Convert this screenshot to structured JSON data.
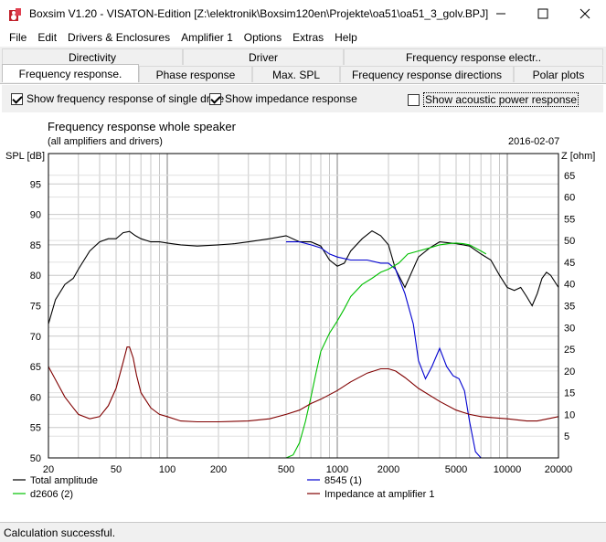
{
  "window": {
    "title": "Boxsim V1.20 - VISATON-Edition [Z:\\elektronik\\Boxsim120en\\Projekte\\oa51\\oa51_3_golv.BPJ]"
  },
  "menu": [
    "File",
    "Edit",
    "Drivers & Enclosures",
    "Amplifier 1",
    "Options",
    "Extras",
    "Help"
  ],
  "tabs_row1": [
    "Directivity",
    "Driver",
    "Frequency response electr.."
  ],
  "tabs_row2": [
    "Frequency response.",
    "Phase response",
    "Max. SPL",
    "Frequency response directions",
    "Polar plots"
  ],
  "active_tab": "Frequency response.",
  "options": {
    "single_drive": {
      "label": "Show frequency response of single drive",
      "checked": true
    },
    "impedance": {
      "label": "Show impedance response",
      "checked": true
    },
    "acoustic_power": {
      "label": "Show acoustic power response",
      "checked": false
    }
  },
  "status": "Calculation successful.",
  "chart_data": {
    "type": "line",
    "title": "Frequency response whole speaker",
    "subtitle": "(all amplifiers and drivers)",
    "date": "2016-02-07",
    "ylabel": "SPL [dB]",
    "y2label": "Z [ohm]",
    "xscale": "log",
    "xlim": [
      20,
      20000
    ],
    "ylim": [
      50,
      100
    ],
    "y2lim": [
      0,
      70
    ],
    "xticks": [
      20,
      50,
      100,
      200,
      500,
      1000,
      2000,
      5000,
      10000,
      20000
    ],
    "xticklabels": [
      "20",
      "50",
      "100",
      "200",
      "500",
      "1000",
      "2000",
      "5000",
      "10000",
      "20000"
    ],
    "yticks": [
      50,
      55,
      60,
      65,
      70,
      75,
      80,
      85,
      90,
      95
    ],
    "y2ticks": [
      5,
      10,
      15,
      20,
      25,
      30,
      35,
      40,
      45,
      50,
      55,
      60,
      65
    ],
    "grid": true,
    "legend_position": "bottom",
    "colors": {
      "total": "#000000",
      "d2606": "#00c000",
      "8545": "#0000d0",
      "impedance": "#800000"
    },
    "series": [
      {
        "name": "Total amplitude",
        "axis": "left",
        "color": "#000000",
        "x": [
          20,
          22,
          25,
          28,
          30,
          35,
          40,
          45,
          50,
          55,
          60,
          65,
          70,
          80,
          90,
          100,
          120,
          150,
          200,
          250,
          300,
          400,
          500,
          600,
          700,
          800,
          900,
          1000,
          1100,
          1200,
          1400,
          1600,
          1800,
          2000,
          2200,
          2500,
          3000,
          3500,
          4000,
          5000,
          6000,
          7000,
          8000,
          9000,
          10000,
          11000,
          12000,
          13000,
          14000,
          15000,
          16000,
          17000,
          18000,
          20000
        ],
        "y": [
          72,
          76,
          78.5,
          79.5,
          81,
          84,
          85.5,
          86,
          86,
          87,
          87.2,
          86.5,
          86,
          85.5,
          85.5,
          85.3,
          85,
          84.8,
          85,
          85.2,
          85.5,
          86,
          86.5,
          85.5,
          85.5,
          84.8,
          82.5,
          81.5,
          82,
          84,
          86,
          87.3,
          86.5,
          85,
          81,
          78,
          83,
          84.5,
          85.5,
          85.2,
          84.8,
          83.5,
          82.5,
          80,
          78,
          77.5,
          78,
          76.5,
          75,
          77,
          79.5,
          80.5,
          80,
          78
        ]
      },
      {
        "name": "8545 (1)",
        "axis": "left",
        "color": "#0000d0",
        "x": [
          500,
          600,
          700,
          800,
          900,
          1000,
          1200,
          1500,
          1800,
          2000,
          2200,
          2500,
          2800,
          3000,
          3300,
          3600,
          4000,
          4400,
          4800,
          5200,
          5600,
          6000,
          6500,
          7000,
          8000,
          10000,
          20000
        ],
        "y": [
          85.5,
          85.5,
          85,
          84.5,
          83.5,
          83,
          82.5,
          82.5,
          82,
          82,
          81,
          77,
          72,
          66,
          63,
          65,
          68,
          65,
          63.5,
          63,
          61,
          56,
          51,
          50,
          50,
          50,
          50
        ]
      },
      {
        "name": "d2606 (2)",
        "axis": "left",
        "color": "#00c000",
        "x": [
          20,
          100,
          500,
          550,
          600,
          650,
          700,
          750,
          800,
          900,
          1000,
          1100,
          1200,
          1400,
          1600,
          1800,
          2000,
          2300,
          2600,
          3000,
          3500,
          4000,
          4500,
          5000,
          5500,
          6000,
          7000,
          7500
        ],
        "y": [
          50,
          50,
          50,
          50.5,
          52.5,
          56,
          60,
          64,
          67.5,
          70.5,
          72.5,
          74.5,
          76.5,
          78.5,
          79.5,
          80.5,
          81,
          82,
          83.5,
          84,
          84.5,
          85,
          85.2,
          85.3,
          85.2,
          85,
          84,
          83.5
        ]
      },
      {
        "name": "Impedance at amplifier 1",
        "axis": "right",
        "color": "#800000",
        "x": [
          20,
          22,
          25,
          28,
          30,
          35,
          40,
          45,
          50,
          55,
          58,
          60,
          63,
          66,
          70,
          80,
          90,
          100,
          120,
          150,
          200,
          300,
          400,
          500,
          600,
          700,
          800,
          1000,
          1200,
          1500,
          1800,
          2000,
          2200,
          2500,
          3000,
          4000,
          5000,
          6000,
          7000,
          8000,
          10000,
          13000,
          15000,
          20000
        ],
        "y": [
          21,
          18,
          14,
          11.5,
          10,
          9,
          9.5,
          12,
          16,
          22,
          25.5,
          25.5,
          23,
          19,
          15,
          11.5,
          10,
          9.5,
          8.5,
          8.3,
          8.3,
          8.5,
          9,
          10,
          11,
          12.5,
          13.5,
          15.5,
          17.5,
          19.5,
          20.5,
          20.5,
          20,
          18.5,
          16,
          13,
          11,
          10,
          9.5,
          9.3,
          9,
          8.5,
          8.5,
          9.5
        ]
      }
    ]
  }
}
